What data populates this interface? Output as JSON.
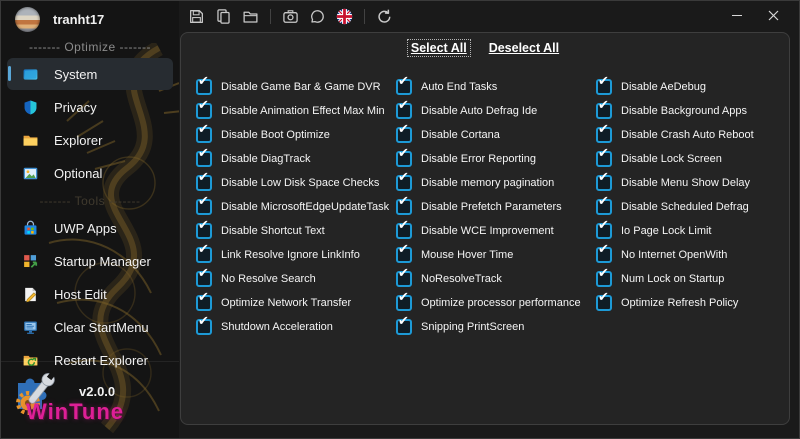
{
  "titlebar": {
    "user": "tranht17",
    "toolbar_groups": [
      [
        "save",
        "paste",
        "open-folder"
      ],
      [
        "screenshot",
        "chat",
        "language-english"
      ],
      [
        "refresh"
      ]
    ]
  },
  "sidebar": {
    "sections": [
      {
        "header": "------- Optimize -------",
        "muted": false,
        "items": [
          {
            "id": "system",
            "label": "System",
            "icon": "system",
            "selected": true
          },
          {
            "id": "privacy",
            "label": "Privacy",
            "icon": "privacy",
            "selected": false
          },
          {
            "id": "explorer",
            "label": "Explorer",
            "icon": "explorer",
            "selected": false
          },
          {
            "id": "optional",
            "label": "Optional",
            "icon": "optional",
            "selected": false
          }
        ]
      },
      {
        "header": "------- Tools -------",
        "muted": true,
        "items": [
          {
            "id": "uwp-apps",
            "label": "UWP Apps",
            "icon": "uwp-apps",
            "selected": false
          },
          {
            "id": "startup-manager",
            "label": "Startup Manager",
            "icon": "startup-manager",
            "selected": false
          },
          {
            "id": "host-edit",
            "label": "Host Edit",
            "icon": "host-edit",
            "selected": false
          },
          {
            "id": "clear-startmenu",
            "label": "Clear StartMenu",
            "icon": "clear-startmenu",
            "selected": false
          },
          {
            "id": "restart-explorer",
            "label": "Restart Explorer",
            "icon": "restart-explorer",
            "selected": false
          }
        ]
      }
    ],
    "footer": {
      "version": "v2.0.0",
      "brand": "WinTune"
    }
  },
  "main": {
    "select_all": "Select All",
    "deselect_all": "Deselect All",
    "columns": [
      [
        {
          "label": "Disable Game Bar & Game DVR",
          "checked": true
        },
        {
          "label": "Disable Animation Effect Max Min",
          "checked": true
        },
        {
          "label": "Disable Boot Optimize",
          "checked": true
        },
        {
          "label": "Disable DiagTrack",
          "checked": true
        },
        {
          "label": "Disable Low Disk Space Checks",
          "checked": true
        },
        {
          "label": "Disable MicrosoftEdgeUpdateTask",
          "checked": true
        },
        {
          "label": "Disable Shortcut Text",
          "checked": true
        },
        {
          "label": "Link Resolve Ignore LinkInfo",
          "checked": true
        },
        {
          "label": "No Resolve Search",
          "checked": true
        },
        {
          "label": "Optimize Network Transfer",
          "checked": true
        },
        {
          "label": "Shutdown Acceleration",
          "checked": true
        }
      ],
      [
        {
          "label": "Auto End Tasks",
          "checked": true
        },
        {
          "label": "Disable Auto Defrag Ide",
          "checked": true
        },
        {
          "label": "Disable Cortana",
          "checked": true
        },
        {
          "label": "Disable Error Reporting",
          "checked": true
        },
        {
          "label": "Disable memory pagination",
          "checked": true
        },
        {
          "label": "Disable Prefetch Parameters",
          "checked": true
        },
        {
          "label": "Disable WCE Improvement",
          "checked": true
        },
        {
          "label": "Mouse Hover Time",
          "checked": true
        },
        {
          "label": "NoResolveTrack",
          "checked": true
        },
        {
          "label": "Optimize processor performance",
          "checked": true
        },
        {
          "label": "Snipping PrintScreen",
          "checked": true
        }
      ],
      [
        {
          "label": "Disable AeDebug",
          "checked": true
        },
        {
          "label": "Disable Background Apps",
          "checked": true
        },
        {
          "label": "Disable Crash Auto Reboot",
          "checked": true
        },
        {
          "label": "Disable Lock Screen",
          "checked": true
        },
        {
          "label": "Disable Menu Show Delay",
          "checked": true
        },
        {
          "label": "Disable Scheduled Defrag",
          "checked": true
        },
        {
          "label": "Io Page Lock Limit",
          "checked": true
        },
        {
          "label": "No Internet OpenWith",
          "checked": true
        },
        {
          "label": "Num Lock on Startup",
          "checked": true
        },
        {
          "label": "Optimize Refresh Policy",
          "checked": true
        }
      ]
    ]
  },
  "colors": {
    "checkbox_accent": "#1d9ad6",
    "selection_indicator": "#5aa7d8",
    "brand_magenta": "#de1f96",
    "panel_bg": "#242424",
    "window_bg": "#1a1a1a"
  }
}
